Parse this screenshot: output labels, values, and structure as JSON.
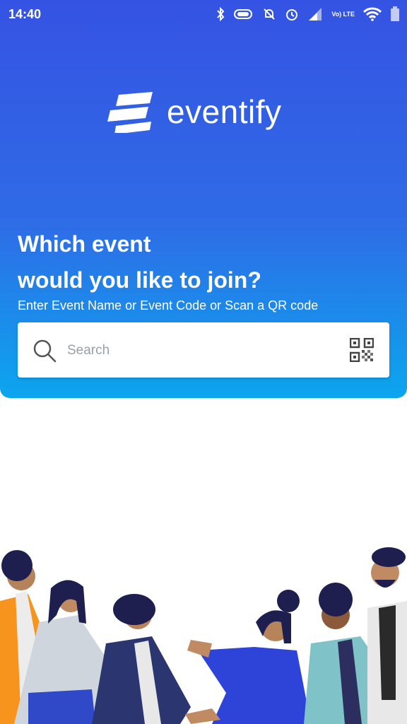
{
  "status_bar": {
    "time": "14:40",
    "network": "Vo) LTE",
    "icons": [
      "bluetooth-icon",
      "battery-saver-icon",
      "notifications-off-icon",
      "alarm-icon",
      "signal-icon",
      "volte-icon",
      "wifi-icon",
      "battery-icon"
    ]
  },
  "brand": {
    "name": "eventify",
    "color": "#ffffff"
  },
  "hero": {
    "title_line1": "Which event",
    "title_line2": "would you like to join?",
    "subtitle": "Enter Event Name or Event Code or Scan a QR code",
    "gradient_top": "#3553e3",
    "gradient_bottom": "#0ba6ee"
  },
  "search": {
    "placeholder": "Search",
    "value": "",
    "qr_icon": "qr-code-icon"
  },
  "illustration": {
    "subject": "group-of-people-holding-hands"
  }
}
